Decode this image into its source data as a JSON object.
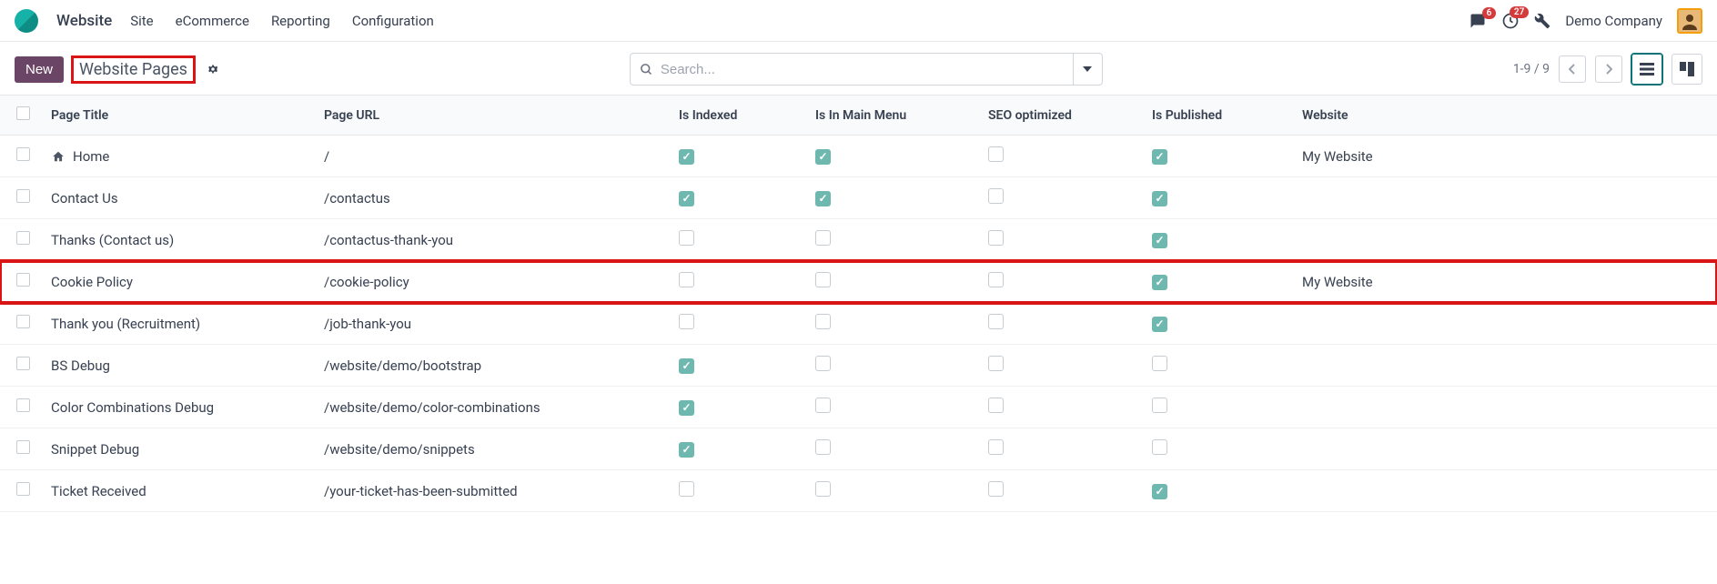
{
  "app_name": "Website",
  "nav": [
    "Site",
    "eCommerce",
    "Reporting",
    "Configuration"
  ],
  "msg_badge": "6",
  "activity_badge": "27",
  "company": "Demo Company",
  "new_btn": "New",
  "breadcrumb": "Website Pages",
  "search": {
    "placeholder": "Search..."
  },
  "pager": "1-9 / 9",
  "columns": {
    "title": "Page Title",
    "url": "Page URL",
    "indexed": "Is Indexed",
    "mainmenu": "Is In Main Menu",
    "seo": "SEO optimized",
    "published": "Is Published",
    "website": "Website"
  },
  "rows": [
    {
      "title": "Home",
      "url": "/",
      "indexed": true,
      "mainmenu": true,
      "seo": false,
      "published": true,
      "website": "My Website",
      "home_icon": true
    },
    {
      "title": "Contact Us",
      "url": "/contactus",
      "indexed": true,
      "mainmenu": true,
      "seo": false,
      "published": true,
      "website": ""
    },
    {
      "title": "Thanks (Contact us)",
      "url": "/contactus-thank-you",
      "indexed": false,
      "mainmenu": false,
      "seo": false,
      "published": true,
      "website": ""
    },
    {
      "title": "Cookie Policy",
      "url": "/cookie-policy",
      "indexed": false,
      "mainmenu": false,
      "seo": false,
      "published": true,
      "website": "My Website",
      "highlighted": true
    },
    {
      "title": "Thank you (Recruitment)",
      "url": "/job-thank-you",
      "indexed": false,
      "mainmenu": false,
      "seo": false,
      "published": true,
      "website": ""
    },
    {
      "title": "BS Debug",
      "url": "/website/demo/bootstrap",
      "indexed": true,
      "mainmenu": false,
      "seo": false,
      "published": false,
      "website": ""
    },
    {
      "title": "Color Combinations Debug",
      "url": "/website/demo/color-combinations",
      "indexed": true,
      "mainmenu": false,
      "seo": false,
      "published": false,
      "website": ""
    },
    {
      "title": "Snippet Debug",
      "url": "/website/demo/snippets",
      "indexed": true,
      "mainmenu": false,
      "seo": false,
      "published": false,
      "website": ""
    },
    {
      "title": "Ticket Received",
      "url": "/your-ticket-has-been-submitted",
      "indexed": false,
      "mainmenu": false,
      "seo": false,
      "published": true,
      "website": ""
    }
  ]
}
